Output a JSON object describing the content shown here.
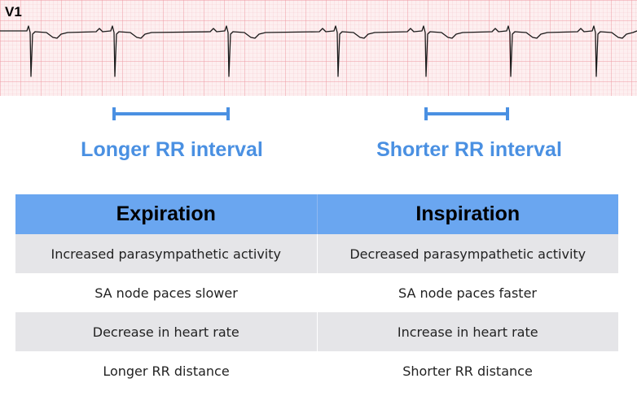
{
  "colors": {
    "accent": "#4a90e2",
    "header_bg": "#6aa6f0",
    "row_bg": "#e5e5e8",
    "ecg_grid_minor": "#f6c9cd",
    "ecg_grid_major": "#ef9aa2",
    "ecg_background": "#fdeff0",
    "trace": "#1a1a1a"
  },
  "ecg": {
    "lead": "V1",
    "beat_count": 8,
    "irregular_rhythm": true
  },
  "intervals": {
    "left_label": "Longer RR interval",
    "right_label": "Shorter RR interval"
  },
  "table": {
    "headers": [
      "Expiration",
      "Inspiration"
    ],
    "rows": [
      [
        "Increased parasympathetic activity",
        "Decreased parasympathetic activity"
      ],
      [
        "SA node paces slower",
        "SA node paces faster"
      ],
      [
        "Decrease in heart rate",
        "Increase in heart rate"
      ],
      [
        "Longer RR distance",
        "Shorter RR distance"
      ]
    ]
  }
}
